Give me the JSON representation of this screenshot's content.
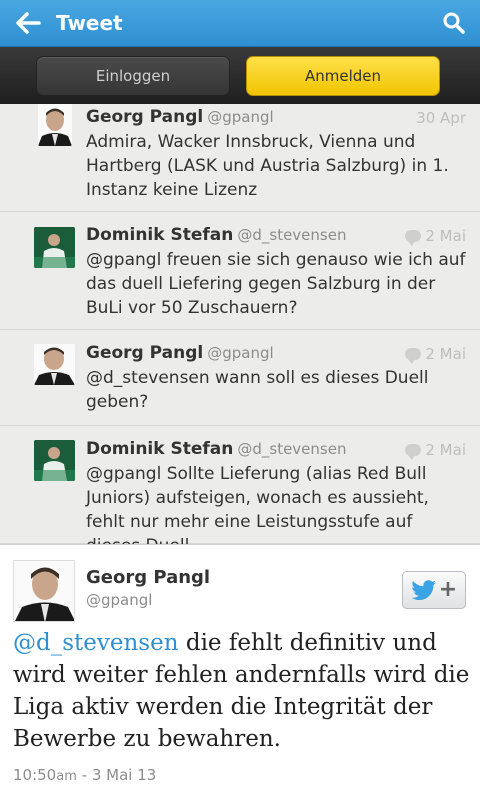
{
  "header": {
    "title": "Tweet",
    "back_icon": "back-arrow-icon",
    "search_icon": "search-icon"
  },
  "auth": {
    "login_label": "Einloggen",
    "signup_label": "Anmelden"
  },
  "conversation": [
    {
      "name": "Georg Pangl",
      "handle": "@gpangl",
      "date": "30 Apr",
      "text": "Admira, Wacker Innsbruck, Vienna und Hartberg (LASK und Austria Salzburg) in 1. Instanz keine Lizenz"
    },
    {
      "name": "Dominik Stefan",
      "handle": "@d_stevensen",
      "date": "2 Mai",
      "text": "@gpangl freuen sie sich genauso wie ich auf das duell Liefering gegen Salzburg in der BuLi vor 50 Zuschauern?"
    },
    {
      "name": "Georg Pangl",
      "handle": "@gpangl",
      "date": "2 Mai",
      "text": "@d_stevensen wann soll es dieses Duell geben?"
    },
    {
      "name": "Dominik Stefan",
      "handle": "@d_stevensen",
      "date": "2 Mai",
      "text": "@gpangl Sollte Lieferung (alias Red Bull Juniors) aufsteigen, wonach es aussieht, fehlt nur mehr eine Leistungsstufe auf dieses Duell"
    }
  ],
  "focused": {
    "name": "Georg Pangl",
    "handle": "@gpangl",
    "mention": "@d_stevensen",
    "text": " die fehlt definitiv und wird weiter fehlen andernfalls wird die Liga aktiv werden die Integrität der Bewerbe zu bewahren.",
    "time": "10:50",
    "ampm": "am",
    "date": " - 3 Mai 13",
    "follow_icon": "twitter-bird-icon"
  },
  "colors": {
    "accent": "#2f8fd0",
    "signup": "#f0c400"
  }
}
